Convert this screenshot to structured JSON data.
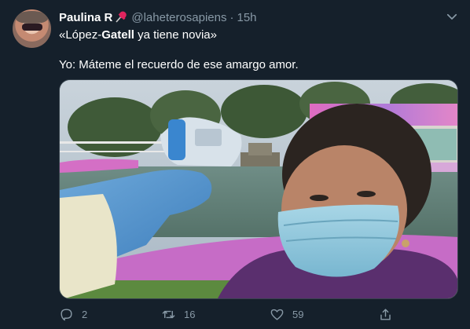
{
  "tweet": {
    "author_name": "Paulina R",
    "handle": "@laheterosapiens",
    "separator": "·",
    "time": "15h",
    "line1_prefix": "«López-",
    "line1_bold": "Gatell",
    "line1_suffix": " ya tiene novia»",
    "line2": "Yo: Máteme el recuerdo de ese amargo amor."
  },
  "actions": {
    "replies": "2",
    "retweets": "16",
    "likes": "59"
  },
  "icons": {
    "pin": "pushpin-icon",
    "menu": "chevron-down-icon",
    "reply": "reply-icon",
    "retweet": "retweet-icon",
    "like": "heart-icon",
    "share": "share-icon"
  },
  "colors": {
    "background": "#15202b",
    "secondary_text": "#8899a6",
    "border": "#38444d",
    "pin": "#e0245e"
  }
}
